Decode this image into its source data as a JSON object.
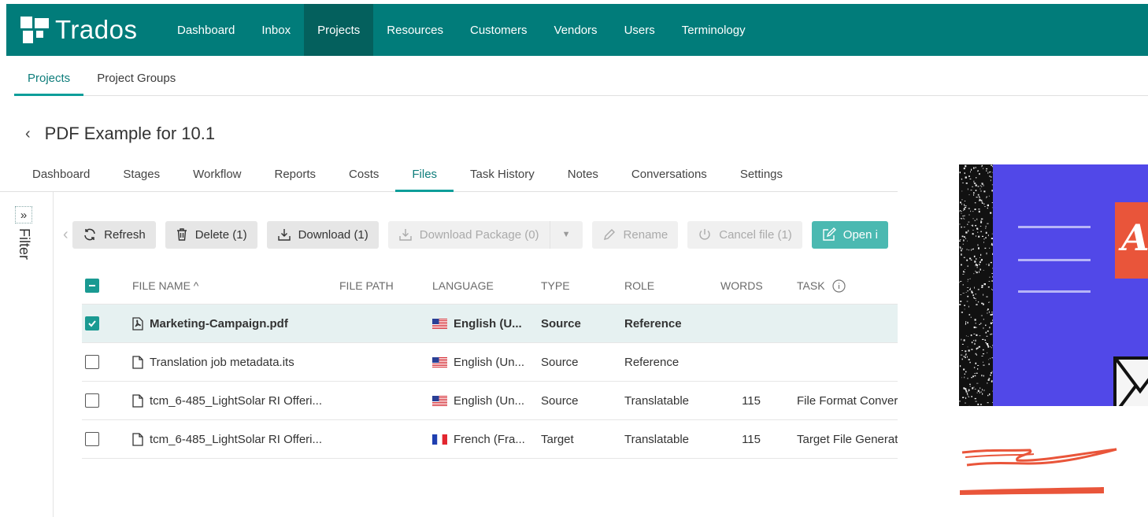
{
  "app": {
    "brand": "Trados"
  },
  "topnav": {
    "items": [
      {
        "label": "Dashboard",
        "active": false
      },
      {
        "label": "Inbox",
        "active": false
      },
      {
        "label": "Projects",
        "active": true
      },
      {
        "label": "Resources",
        "active": false
      },
      {
        "label": "Customers",
        "active": false
      },
      {
        "label": "Vendors",
        "active": false
      },
      {
        "label": "Users",
        "active": false
      },
      {
        "label": "Terminology",
        "active": false
      }
    ]
  },
  "subnav": {
    "items": [
      {
        "label": "Projects",
        "active": true
      },
      {
        "label": "Project Groups",
        "active": false
      }
    ]
  },
  "project": {
    "title": "PDF Example for 10.1"
  },
  "tabs": [
    {
      "label": "Dashboard",
      "active": false
    },
    {
      "label": "Stages",
      "active": false
    },
    {
      "label": "Workflow",
      "active": false
    },
    {
      "label": "Reports",
      "active": false
    },
    {
      "label": "Costs",
      "active": false
    },
    {
      "label": "Files",
      "active": true
    },
    {
      "label": "Task History",
      "active": false
    },
    {
      "label": "Notes",
      "active": false
    },
    {
      "label": "Conversations",
      "active": false
    },
    {
      "label": "Settings",
      "active": false
    }
  ],
  "filter": {
    "toggle": "»",
    "label": "Filter"
  },
  "toolbar": {
    "refresh": "Refresh",
    "delete": "Delete (1)",
    "download": "Download (1)",
    "download_package": "Download Package (0)",
    "rename": "Rename",
    "cancel_file": "Cancel file (1)",
    "open_in": "Open i"
  },
  "table": {
    "headers": {
      "file_name": "FILE NAME ^",
      "file_path": "FILE PATH",
      "language": "LANGUAGE",
      "type": "TYPE",
      "role": "ROLE",
      "words": "WORDS",
      "task": "TASK"
    },
    "rows": [
      {
        "checked": true,
        "icon": "pdf-file-icon",
        "name": "Marketing-Campaign.pdf",
        "path": "",
        "flag": "us",
        "language": "English (U...",
        "type": "Source",
        "role": "Reference",
        "words": "",
        "task": ""
      },
      {
        "checked": false,
        "icon": "file-icon",
        "name": "Translation job metadata.its",
        "path": "",
        "flag": "us",
        "language": "English (Un...",
        "type": "Source",
        "role": "Reference",
        "words": "",
        "task": ""
      },
      {
        "checked": false,
        "icon": "file-icon",
        "name": "tcm_6-485_LightSolar RI Offeri...",
        "path": "",
        "flag": "us",
        "language": "English (Un...",
        "type": "Source",
        "role": "Translatable",
        "words": "115",
        "task": "File Format Convers"
      },
      {
        "checked": false,
        "icon": "file-icon",
        "name": "tcm_6-485_LightSolar RI Offeri...",
        "path": "",
        "flag": "fr",
        "language": "French (Fra...",
        "type": "Target",
        "role": "Translatable",
        "words": "115",
        "task": "Target File Generati"
      }
    ]
  },
  "promo": {
    "letter": "A"
  },
  "colors": {
    "brand": "#017c7a",
    "brand_active": "#04605d",
    "accent": "#1a9a92",
    "promo_bg": "#5148e8",
    "promo_red": "#e9553a"
  }
}
